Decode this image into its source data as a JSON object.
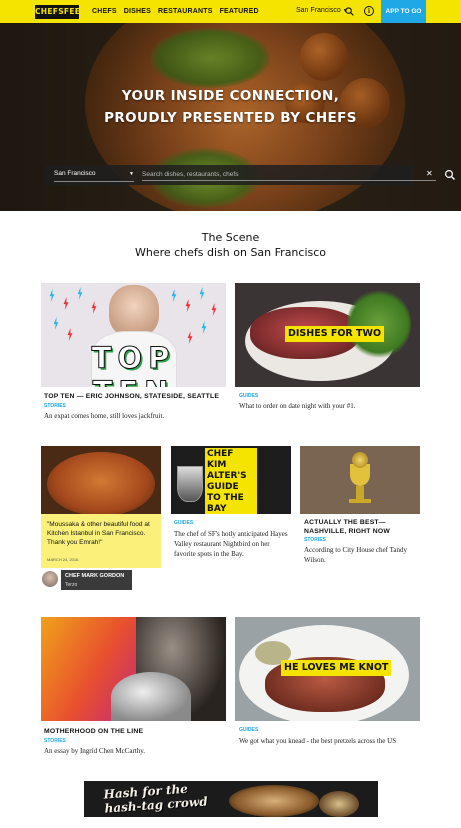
{
  "nav": {
    "logo": "CHEFSFEED",
    "links": [
      "CHEFS",
      "DISHES",
      "RESTAURANTS",
      "FEATURED"
    ],
    "city": "San Francisco",
    "app_button": "APP TO GO",
    "search_icon": "search-icon",
    "info_icon": "info-icon"
  },
  "hero": {
    "title_line1": "YOUR INSIDE CONNECTION,",
    "title_line2": "PROUDLY PRESENTED BY CHEFS",
    "city_select": "San Francisco",
    "search_placeholder": "Search dishes, restaurants, chefs",
    "clear_glyph": "✕"
  },
  "scene": {
    "title": "The Scene",
    "subtitle": "Where chefs dish on San Francisco"
  },
  "cards": {
    "top_ten": {
      "overlay": "TOP TEN",
      "title": "TOP TEN — ERIC JOHNSON, STATESIDE, SEATTLE",
      "category": "STORIES",
      "desc": "An expat comes home, still loves jackfruit."
    },
    "dishes_for_two": {
      "overlay": "DISHES FOR TWO",
      "category": "GUIDES",
      "desc": "What to order on date night with your #1."
    },
    "quote": {
      "text": "\"Moussaka & other beautiful food at Kitchen Istanbul in San Francisco. Thank you Emrah!\"",
      "date": "MARCH 24, 2016",
      "chef": "CHEF MARK GORDON",
      "restaurant": "Terzo"
    },
    "bay_area": {
      "overlay": "CHEF KIM ALTER'S GUIDE TO THE BAY AREA",
      "category": "GUIDES",
      "desc": "The chef of SF's hotly anticipated Hayes Valley restaurant Nightbird on her favorite spots in the Bay."
    },
    "nashville": {
      "title": "ACTUALLY THE BEST—NASHVILLE, RIGHT NOW",
      "category": "STORIES",
      "desc": "According to City House chef Tandy Wilson."
    },
    "motherhood": {
      "title": "MOTHERHOOD ON THE LINE",
      "category": "STORIES",
      "desc": "An essay by Ingrid Chen McCarthy."
    },
    "knot": {
      "overlay": "HE LOVES ME KNOT",
      "category": "GUIDES",
      "desc": "We got what you knead - the best pretzels across the US"
    }
  },
  "banner": {
    "line1": "Hash for the",
    "line2": "hash-tag crowd"
  },
  "colors": {
    "brand_yellow": "#f5e400",
    "accent_blue": "#1fa7e6"
  }
}
